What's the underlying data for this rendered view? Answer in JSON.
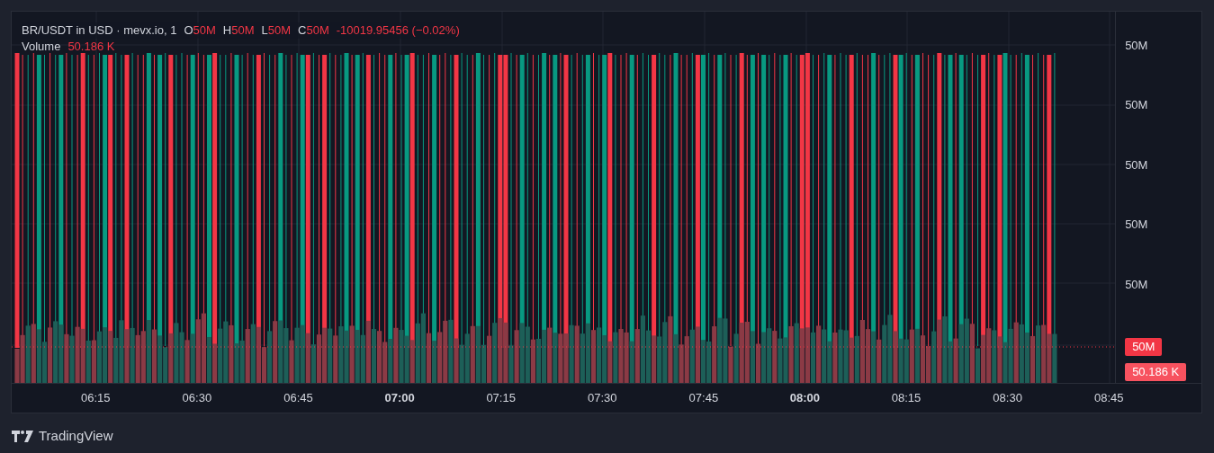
{
  "legend": {
    "symbol": "BR/USDT in USD · mevx.io, 1",
    "ohlc": [
      {
        "label": "O",
        "value": "50M"
      },
      {
        "label": "H",
        "value": "50M"
      },
      {
        "label": "L",
        "value": "50M"
      },
      {
        "label": "C",
        "value": "50M"
      }
    ],
    "change": "-10019.95456 (−0.02%)",
    "volume_label": "Volume",
    "volume_value": "50.186 K"
  },
  "price_axis": {
    "ticks": [
      "50M",
      "50M",
      "50M",
      "50M",
      "50M"
    ],
    "price_label": "50M",
    "volume_label": "50.186 K"
  },
  "time_axis": [
    {
      "label": "06:15",
      "major": false
    },
    {
      "label": "06:30",
      "major": false
    },
    {
      "label": "06:45",
      "major": false
    },
    {
      "label": "07:00",
      "major": true
    },
    {
      "label": "07:15",
      "major": false
    },
    {
      "label": "07:30",
      "major": false
    },
    {
      "label": "07:45",
      "major": false
    },
    {
      "label": "08:00",
      "major": true
    },
    {
      "label": "08:15",
      "major": false
    },
    {
      "label": "08:30",
      "major": false
    },
    {
      "label": "08:45",
      "major": false
    }
  ],
  "footer": {
    "brand": "TradingView"
  }
}
